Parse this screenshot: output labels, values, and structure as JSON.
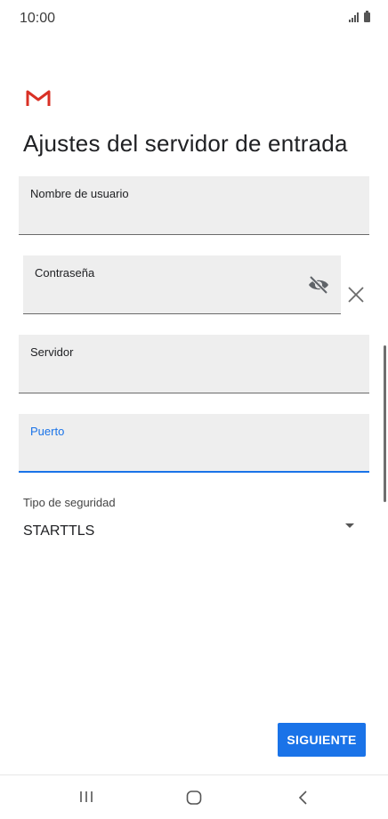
{
  "status_bar": {
    "time": "10:00"
  },
  "app": {
    "logo_icon": "gmail-logo",
    "brand_color": "#d93025"
  },
  "page": {
    "title": "Ajustes del servidor de entrada"
  },
  "fields": {
    "username": {
      "label": "Nombre de usuario",
      "value": ""
    },
    "password": {
      "label": "Contraseña",
      "value": "",
      "visibility_icon": "eye-off-icon",
      "clear_icon": "close-icon"
    },
    "server": {
      "label": "Servidor",
      "value": ""
    },
    "port": {
      "label": "Puerto",
      "value": "",
      "focused": true
    }
  },
  "security": {
    "label": "Tipo de seguridad",
    "selected": "STARTTLS"
  },
  "actions": {
    "next_label": "SIGUIENTE"
  },
  "colors": {
    "accent": "#1a73e8",
    "field_background": "#eeeeee"
  },
  "nav_bar": {
    "recents_icon": "recents-icon",
    "home_icon": "home-icon",
    "back_icon": "back-icon"
  }
}
